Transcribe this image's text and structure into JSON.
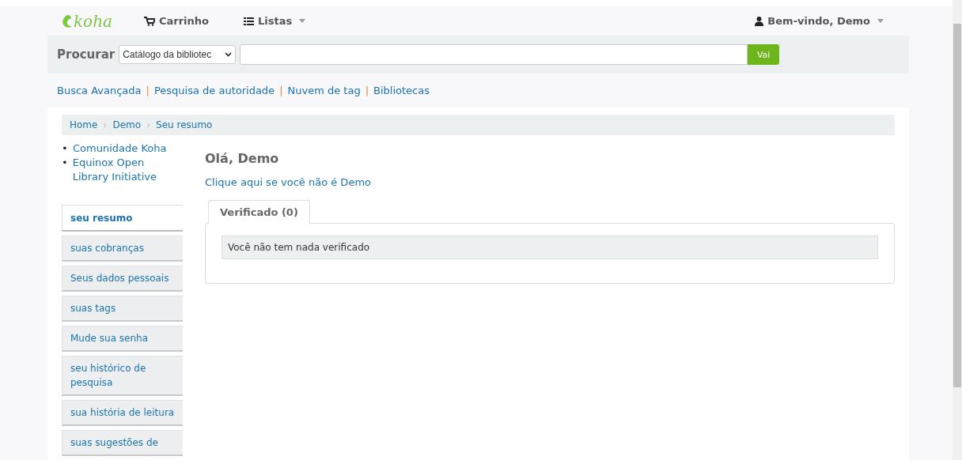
{
  "navbar": {
    "logo": "koha",
    "items": [
      {
        "label": "Carrinho",
        "kind": "cart",
        "dropdown": false
      },
      {
        "label": "Listas",
        "kind": "list",
        "dropdown": true
      }
    ],
    "user": {
      "label": "Bem-vindo, Demo",
      "dropdown": true
    }
  },
  "search": {
    "label": "Procurar",
    "scope": "Catálogo da bibliotec",
    "button": "Vai"
  },
  "link_separator": "|",
  "links": [
    "Busca Avançada",
    "Pesquisa de autoridade",
    "Nuvem de tag",
    "Bibliotecas"
  ],
  "breadcrumbs": [
    "Home",
    "Demo",
    "Seu resumo"
  ],
  "sidebar": {
    "bullet": "•",
    "links": [
      "Comunidade Koha",
      "Equinox Open Library Initiative"
    ],
    "items": [
      {
        "label": "seu resumo",
        "selected": true
      },
      {
        "label": "suas cobranças",
        "selected": false
      },
      {
        "label": "Seus dados pessoais",
        "selected": false
      },
      {
        "label": "suas tags",
        "selected": false
      },
      {
        "label": "Mude sua senha",
        "selected": false
      },
      {
        "label": "seu histórico de pesquisa",
        "selected": false
      },
      {
        "label": "sua história de leitura",
        "selected": false
      },
      {
        "label": "suas sugestões de",
        "selected": false
      }
    ]
  },
  "main": {
    "heading": "Olá, Demo",
    "switch_link": "Clique aqui se você não é Demo",
    "tabs": [
      {
        "label": "Verificado (0)",
        "selected": true
      }
    ],
    "message": "Você não tem nada verificado"
  }
}
